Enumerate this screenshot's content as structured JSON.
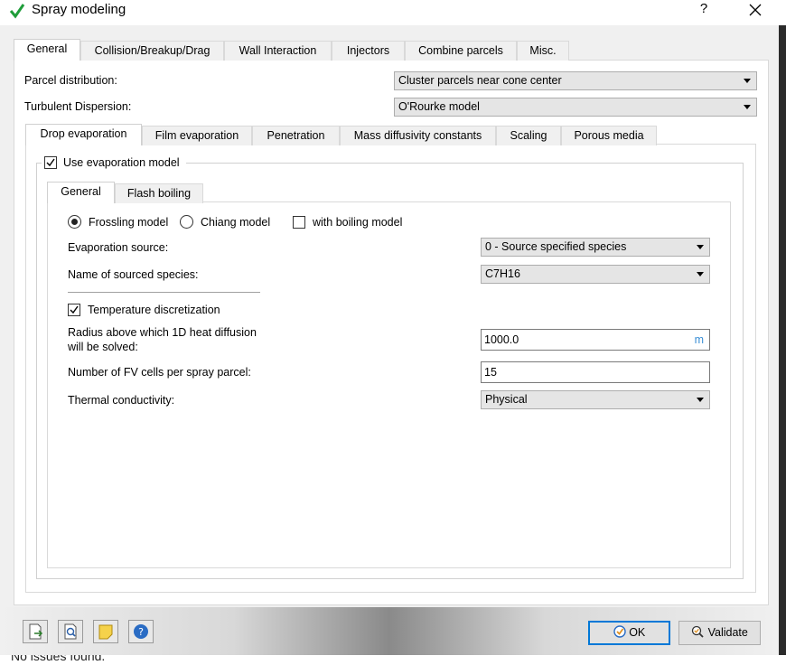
{
  "window": {
    "title": "Spray modeling",
    "help": "?"
  },
  "top_tabs": [
    "General",
    "Collision/Breakup/Drag",
    "Wall Interaction",
    "Injectors",
    "Combine parcels",
    "Misc."
  ],
  "general": {
    "parcel_distribution_label": "Parcel distribution:",
    "parcel_distribution_value": "Cluster parcels near cone center",
    "turbulent_dispersion_label": "Turbulent Dispersion:",
    "turbulent_dispersion_value": "O'Rourke model"
  },
  "sub_tabs": [
    "Drop evaporation",
    "Film evaporation",
    "Penetration",
    "Mass diffusivity constants",
    "Scaling",
    "Porous media"
  ],
  "evaporation": {
    "use_model_label": "Use evaporation model",
    "use_model_checked": true,
    "inner_tabs": [
      "General",
      "Flash boiling"
    ],
    "frossling_label": "Frossling model",
    "chiang_label": "Chiang model",
    "boiling_label": "with boiling model",
    "source_label": "Evaporation source:",
    "source_value": "0 - Source specified species",
    "species_label": "Name of sourced species:",
    "species_value": "C7H16",
    "temp_disc_label": "Temperature discretization",
    "temp_disc_checked": true,
    "radius_label_line1": "Radius above which 1D heat diffusion",
    "radius_label_line2": "will be solved:",
    "radius_value": "1000.0",
    "radius_unit": "m",
    "cells_label": "Number of FV cells per spray parcel:",
    "cells_value": "15",
    "conductivity_label": "Thermal conductivity:",
    "conductivity_value": "Physical"
  },
  "buttons": {
    "ok": "OK",
    "validate": "Validate"
  },
  "background_text": "No issues found."
}
